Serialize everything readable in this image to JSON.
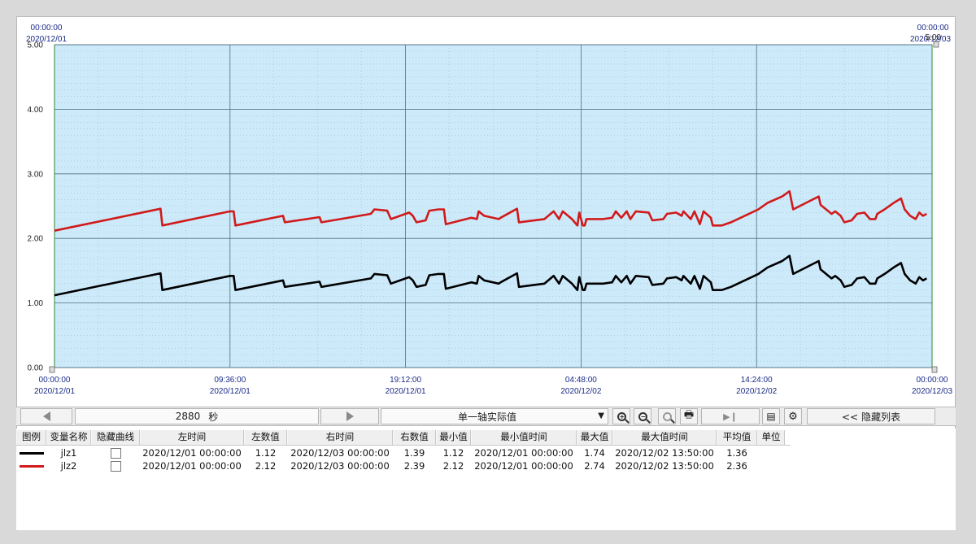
{
  "top_time_left": "00:00:00",
  "top_date_left": "2020/12/01",
  "top_time_right": "00:00:00",
  "top_date_right": "2020/12/03",
  "top_right_value": "5.00",
  "toolbar": {
    "span_value": "2880",
    "span_unit": "秒",
    "mode_select": "单一轴实际值",
    "hide_list_label": "<< 隐藏列表"
  },
  "table": {
    "headers": [
      "图例",
      "变量名称",
      "隐藏曲线",
      "左时间",
      "左数值",
      "右时间",
      "右数值",
      "最小值",
      "最小值时间",
      "最大值",
      "最大值时间",
      "平均值",
      "单位"
    ],
    "rows": [
      {
        "color": "#000000",
        "name": "jlz1",
        "left_time": "2020/12/01 00:00:00",
        "left_val": "1.12",
        "right_time": "2020/12/03 00:00:00",
        "right_val": "1.39",
        "min": "1.12",
        "min_time": "2020/12/01 00:00:00",
        "max": "1.74",
        "max_time": "2020/12/02 13:50:00",
        "avg": "1.36",
        "unit": ""
      },
      {
        "color": "#d11a1a",
        "name": "jlz2",
        "left_time": "2020/12/01 00:00:00",
        "left_val": "2.12",
        "right_time": "2020/12/03 00:00:00",
        "right_val": "2.39",
        "min": "2.12",
        "min_time": "2020/12/01 00:00:00",
        "max": "2.74",
        "max_time": "2020/12/02 13:50:00",
        "avg": "2.36",
        "unit": ""
      }
    ]
  },
  "chart_data": {
    "type": "line",
    "xlabel": "",
    "ylabel": "",
    "ylim": [
      0,
      5
    ],
    "xlim_hours": [
      0,
      48
    ],
    "grid": true,
    "y_ticks": [
      "0.00",
      "1.00",
      "2.00",
      "3.00",
      "4.00",
      "5.00"
    ],
    "x_ticks": [
      {
        "time": "00:00:00",
        "date": "2020/12/01"
      },
      {
        "time": "09:36:00",
        "date": "2020/12/01"
      },
      {
        "time": "19:12:00",
        "date": "2020/12/01"
      },
      {
        "time": "04:48:00",
        "date": "2020/12/02"
      },
      {
        "time": "14:24:00",
        "date": "2020/12/02"
      },
      {
        "time": "00:00:00",
        "date": "2020/12/03"
      }
    ],
    "series": [
      {
        "name": "jlz1",
        "color": "#000000",
        "points": [
          [
            0,
            1.12
          ],
          [
            5.8,
            1.46
          ],
          [
            5.9,
            1.2
          ],
          [
            9.6,
            1.42
          ],
          [
            9.8,
            1.42
          ],
          [
            9.9,
            1.2
          ],
          [
            12.5,
            1.35
          ],
          [
            12.6,
            1.25
          ],
          [
            14.5,
            1.33
          ],
          [
            14.6,
            1.25
          ],
          [
            17.3,
            1.38
          ],
          [
            17.5,
            1.45
          ],
          [
            18.2,
            1.43
          ],
          [
            18.4,
            1.3
          ],
          [
            19.0,
            1.36
          ],
          [
            19.4,
            1.4
          ],
          [
            19.6,
            1.35
          ],
          [
            19.8,
            1.25
          ],
          [
            20.3,
            1.28
          ],
          [
            20.5,
            1.43
          ],
          [
            21.0,
            1.45
          ],
          [
            21.3,
            1.45
          ],
          [
            21.4,
            1.22
          ],
          [
            22.8,
            1.32
          ],
          [
            23.1,
            1.3
          ],
          [
            23.2,
            1.42
          ],
          [
            23.5,
            1.35
          ],
          [
            24.3,
            1.3
          ],
          [
            24.4,
            1.32
          ],
          [
            25.3,
            1.46
          ],
          [
            25.4,
            1.25
          ],
          [
            26.8,
            1.3
          ],
          [
            27.3,
            1.42
          ],
          [
            27.6,
            1.3
          ],
          [
            27.8,
            1.42
          ],
          [
            28.3,
            1.3
          ],
          [
            28.6,
            1.2
          ],
          [
            28.7,
            1.4
          ],
          [
            28.9,
            1.2
          ],
          [
            29.0,
            1.2
          ],
          [
            29.1,
            1.3
          ],
          [
            30.0,
            1.3
          ],
          [
            30.5,
            1.32
          ],
          [
            30.7,
            1.42
          ],
          [
            31.0,
            1.32
          ],
          [
            31.3,
            1.42
          ],
          [
            31.5,
            1.3
          ],
          [
            31.8,
            1.42
          ],
          [
            32.5,
            1.4
          ],
          [
            32.7,
            1.28
          ],
          [
            33.3,
            1.3
          ],
          [
            33.5,
            1.38
          ],
          [
            34.0,
            1.4
          ],
          [
            34.3,
            1.35
          ],
          [
            34.4,
            1.42
          ],
          [
            34.8,
            1.3
          ],
          [
            35.0,
            1.42
          ],
          [
            35.3,
            1.22
          ],
          [
            35.5,
            1.42
          ],
          [
            35.9,
            1.32
          ],
          [
            36.0,
            1.2
          ],
          [
            36.5,
            1.2
          ],
          [
            37.0,
            1.25
          ],
          [
            38.5,
            1.45
          ],
          [
            39.0,
            1.55
          ],
          [
            39.8,
            1.65
          ],
          [
            40.2,
            1.73
          ],
          [
            40.4,
            1.45
          ],
          [
            41.8,
            1.65
          ],
          [
            41.9,
            1.52
          ],
          [
            42.5,
            1.38
          ],
          [
            42.7,
            1.42
          ],
          [
            43.0,
            1.35
          ],
          [
            43.2,
            1.25
          ],
          [
            43.6,
            1.28
          ],
          [
            43.9,
            1.38
          ],
          [
            44.3,
            1.4
          ],
          [
            44.6,
            1.3
          ],
          [
            44.9,
            1.3
          ],
          [
            45.0,
            1.38
          ],
          [
            45.4,
            1.45
          ],
          [
            45.9,
            1.55
          ],
          [
            46.3,
            1.62
          ],
          [
            46.5,
            1.45
          ],
          [
            46.8,
            1.35
          ],
          [
            47.1,
            1.3
          ],
          [
            47.3,
            1.4
          ],
          [
            47.5,
            1.35
          ],
          [
            47.7,
            1.38
          ]
        ]
      },
      {
        "name": "jlz2",
        "color": "#d11a1a",
        "points": [
          [
            0,
            2.12
          ],
          [
            5.8,
            2.46
          ],
          [
            5.9,
            2.2
          ],
          [
            9.6,
            2.42
          ],
          [
            9.8,
            2.42
          ],
          [
            9.9,
            2.2
          ],
          [
            12.5,
            2.35
          ],
          [
            12.6,
            2.25
          ],
          [
            14.5,
            2.33
          ],
          [
            14.6,
            2.25
          ],
          [
            17.3,
            2.38
          ],
          [
            17.5,
            2.45
          ],
          [
            18.2,
            2.43
          ],
          [
            18.4,
            2.3
          ],
          [
            19.0,
            2.36
          ],
          [
            19.4,
            2.4
          ],
          [
            19.6,
            2.35
          ],
          [
            19.8,
            2.25
          ],
          [
            20.3,
            2.28
          ],
          [
            20.5,
            2.43
          ],
          [
            21.0,
            2.45
          ],
          [
            21.3,
            2.45
          ],
          [
            21.4,
            2.22
          ],
          [
            22.8,
            2.32
          ],
          [
            23.1,
            2.3
          ],
          [
            23.2,
            2.42
          ],
          [
            23.5,
            2.35
          ],
          [
            24.3,
            2.3
          ],
          [
            24.4,
            2.32
          ],
          [
            25.3,
            2.46
          ],
          [
            25.4,
            2.25
          ],
          [
            26.8,
            2.3
          ],
          [
            27.3,
            2.42
          ],
          [
            27.6,
            2.3
          ],
          [
            27.8,
            2.42
          ],
          [
            28.3,
            2.3
          ],
          [
            28.6,
            2.2
          ],
          [
            28.7,
            2.4
          ],
          [
            28.9,
            2.2
          ],
          [
            29.0,
            2.2
          ],
          [
            29.1,
            2.3
          ],
          [
            30.0,
            2.3
          ],
          [
            30.5,
            2.32
          ],
          [
            30.7,
            2.42
          ],
          [
            31.0,
            2.32
          ],
          [
            31.3,
            2.42
          ],
          [
            31.5,
            2.3
          ],
          [
            31.8,
            2.42
          ],
          [
            32.5,
            2.4
          ],
          [
            32.7,
            2.28
          ],
          [
            33.3,
            2.3
          ],
          [
            33.5,
            2.38
          ],
          [
            34.0,
            2.4
          ],
          [
            34.3,
            2.35
          ],
          [
            34.4,
            2.42
          ],
          [
            34.8,
            2.3
          ],
          [
            35.0,
            2.42
          ],
          [
            35.3,
            2.22
          ],
          [
            35.5,
            2.42
          ],
          [
            35.9,
            2.32
          ],
          [
            36.0,
            2.2
          ],
          [
            36.5,
            2.2
          ],
          [
            37.0,
            2.25
          ],
          [
            38.5,
            2.45
          ],
          [
            39.0,
            2.55
          ],
          [
            39.8,
            2.65
          ],
          [
            40.2,
            2.73
          ],
          [
            40.4,
            2.45
          ],
          [
            41.8,
            2.65
          ],
          [
            41.9,
            2.52
          ],
          [
            42.5,
            2.38
          ],
          [
            42.7,
            2.42
          ],
          [
            43.0,
            2.35
          ],
          [
            43.2,
            2.25
          ],
          [
            43.6,
            2.28
          ],
          [
            43.9,
            2.38
          ],
          [
            44.3,
            2.4
          ],
          [
            44.6,
            2.3
          ],
          [
            44.9,
            2.3
          ],
          [
            45.0,
            2.38
          ],
          [
            45.4,
            2.45
          ],
          [
            45.9,
            2.55
          ],
          [
            46.3,
            2.62
          ],
          [
            46.5,
            2.45
          ],
          [
            46.8,
            2.35
          ],
          [
            47.1,
            2.3
          ],
          [
            47.3,
            2.4
          ],
          [
            47.5,
            2.35
          ],
          [
            47.7,
            2.38
          ]
        ]
      }
    ]
  }
}
